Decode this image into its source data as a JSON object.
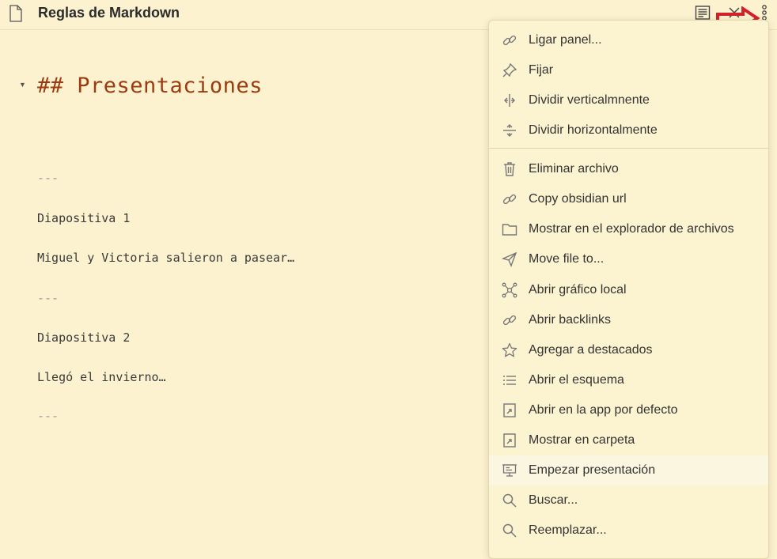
{
  "header": {
    "title": "Reglas de Markdown",
    "icons": [
      "file-icon",
      "reading-view-icon",
      "close-icon",
      "more-options-icon"
    ]
  },
  "editor": {
    "heading": "## Presentaciones",
    "lines": [
      "---",
      "Diapositiva 1",
      "Miguel y Victoria salieron a pasear…",
      "---",
      "Diapositiva 2",
      "Llegó el invierno…",
      "---"
    ]
  },
  "menu": {
    "group1": [
      {
        "label": "Ligar panel...",
        "icon": "link-icon"
      },
      {
        "label": "Fijar",
        "icon": "pin-icon"
      },
      {
        "label": "Dividir verticalmnente",
        "icon": "split-vertical-icon"
      },
      {
        "label": "Dividir horizontalmente",
        "icon": "split-horizontal-icon"
      }
    ],
    "group2": [
      {
        "label": "Eliminar archivo",
        "icon": "trash-icon"
      },
      {
        "label": "Copy obsidian url",
        "icon": "link-icon"
      },
      {
        "label": "Mostrar en el explorador de archivos",
        "icon": "folder-icon"
      },
      {
        "label": "Move file to...",
        "icon": "paper-plane-icon"
      },
      {
        "label": "Abrir gráfico local",
        "icon": "graph-icon"
      },
      {
        "label": "Abrir backlinks",
        "icon": "link-icon"
      },
      {
        "label": "Agregar a destacados",
        "icon": "star-icon"
      },
      {
        "label": "Abrir el esquema",
        "icon": "list-icon"
      },
      {
        "label": "Abrir en la app por defecto",
        "icon": "external-icon"
      },
      {
        "label": "Mostrar en carpeta",
        "icon": "external-icon"
      },
      {
        "label": "Empezar presentación",
        "icon": "presentation-icon",
        "highlighted": true
      },
      {
        "label": "Buscar...",
        "icon": "search-icon"
      },
      {
        "label": "Reemplazar...",
        "icon": "search-icon"
      }
    ]
  },
  "colors": {
    "background": "#fcf2cf",
    "heading": "#9a3c0f",
    "annotation_arrow": "#d3212a"
  }
}
